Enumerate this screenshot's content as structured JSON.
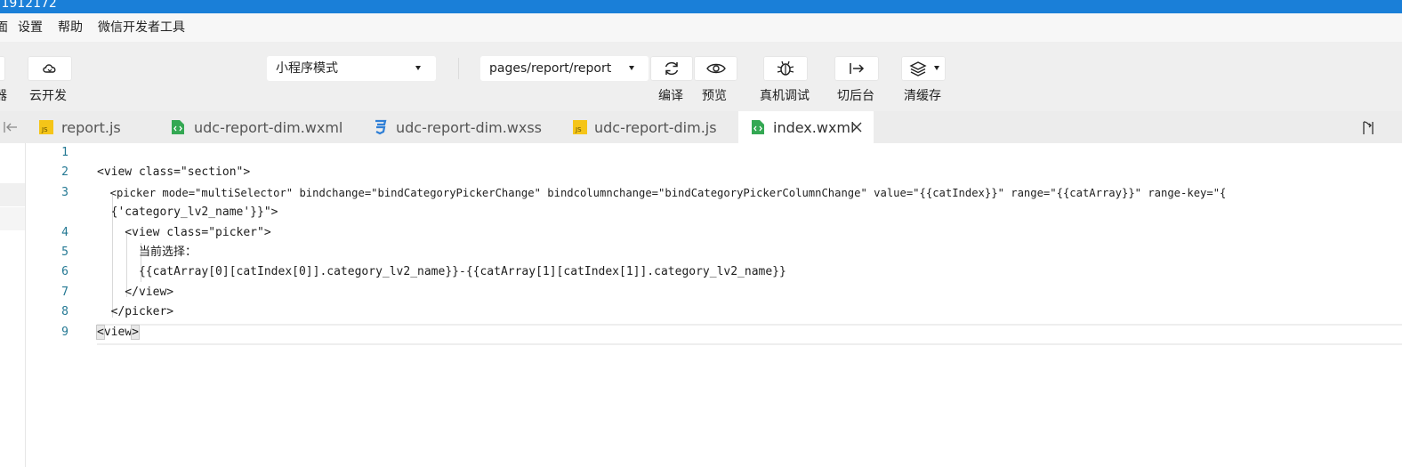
{
  "title_bar": {
    "text": ".1912172"
  },
  "menu": {
    "items": [
      "面",
      "设置",
      "帮助",
      "微信开发者工具"
    ]
  },
  "toolbar": {
    "cutoff_label": "器",
    "cloud_label": "云开发",
    "mode_select": {
      "value": "小程序模式"
    },
    "page_select": {
      "value": "pages/report/report"
    },
    "compile_label": "编译",
    "preview_label": "预览",
    "debug_label": "真机调试",
    "background_label": "切后台",
    "cache_label": "清缓存"
  },
  "tabs": [
    {
      "label": "report.js",
      "type": "js"
    },
    {
      "label": "udc-report-dim.wxml",
      "type": "wxml"
    },
    {
      "label": "udc-report-dim.wxss",
      "type": "wxss"
    },
    {
      "label": "udc-report-dim.js",
      "type": "js"
    },
    {
      "label": "index.wxml",
      "type": "wxml",
      "active": true
    }
  ],
  "editor": {
    "line_numbers": [
      "1",
      "2",
      "3",
      "4",
      "5",
      "6",
      "7",
      "8",
      "9"
    ],
    "lines": [
      "",
      "<view class=\"section\">",
      "  <picker mode=\"multiSelector\" bindchange=\"bindCategoryPickerChange\" bindcolumnchange=\"bindCategoryPickerColumnChange\" value=\"{{catIndex}}\" range=\"{{catArray}}\" range-key=\"{",
      "  {'category_lv2_name'}}\">",
      "    <view class=\"picker\">",
      "      当前选择：",
      "      {{catArray[0][catIndex[0]].category_lv2_name}}-{{catArray[1][catIndex[1]].category_lv2_name}}",
      "    </view>",
      "  </picker>",
      "view"
    ],
    "last_line": {
      "open": "<",
      "close": ">"
    }
  },
  "colors": {
    "titlebar": "#1a7fd8",
    "line_number": "#237893"
  }
}
